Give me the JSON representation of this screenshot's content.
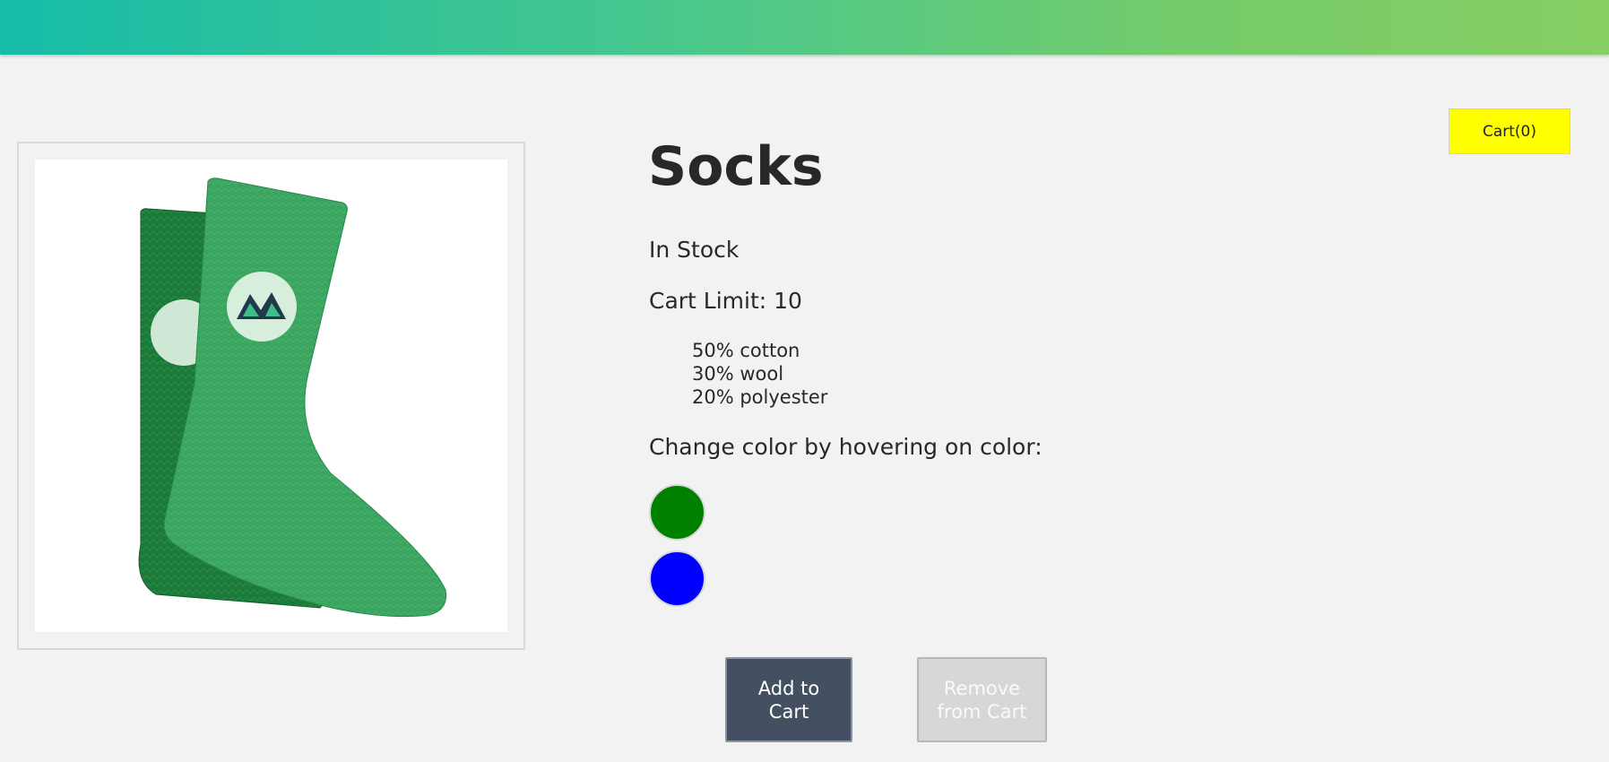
{
  "header": {
    "gradient_start": "#16bca8",
    "gradient_end": "#86cf62"
  },
  "cart": {
    "label": "Cart(0)",
    "background": "#ffff00"
  },
  "product": {
    "image_icon": "green-socks-image",
    "title": "Socks",
    "stock_status": "In Stock",
    "cart_limit": "Cart Limit: 10",
    "details": [
      "50% cotton",
      "30% wool",
      "20% polyester"
    ],
    "color_prompt": "Change color by hovering on color:",
    "variants": [
      {
        "color": "#008000"
      },
      {
        "color": "#0000ff"
      }
    ]
  },
  "actions": {
    "add_line1": "Add to",
    "add_line2": "Cart",
    "remove_line1": "Remove",
    "remove_line2": "from Cart"
  }
}
